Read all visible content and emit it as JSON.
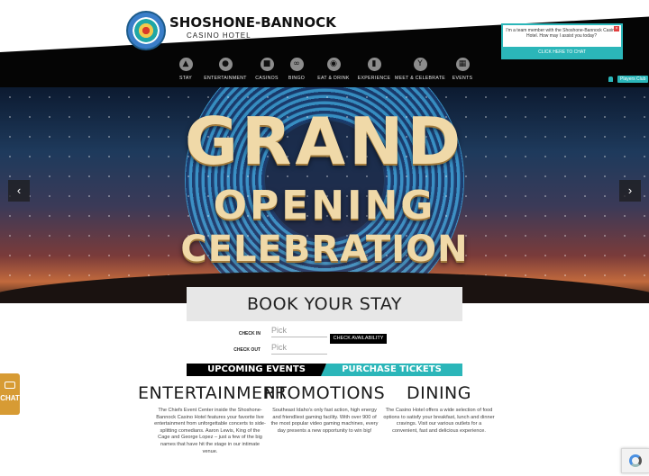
{
  "brand": {
    "name": "SHOSHONE-BANNOCK",
    "subtitle": "CASINO HOTEL"
  },
  "nav": {
    "items": [
      {
        "label": "STAY",
        "icon": "bell-icon"
      },
      {
        "label": "ENTERTAINMENT",
        "icon": "microphone-icon"
      },
      {
        "label": "CASINOS",
        "icon": "slot-machine-icon"
      },
      {
        "label": "BINGO",
        "icon": "bingo-balls-icon"
      },
      {
        "label": "EAT & DRINK",
        "icon": "plate-icon"
      },
      {
        "label": "EXPERIENCE",
        "icon": "backpack-icon"
      },
      {
        "label": "MEET & CELEBRATE",
        "icon": "glasses-icon"
      },
      {
        "label": "EVENTS",
        "icon": "calendar-icon"
      }
    ],
    "players_club": "Players Club"
  },
  "chat_popup": {
    "message": "I'm a team member with the Shoshone-Bannock Casino Hotel. How may I assist you today?",
    "button": "CLICK HERE TO CHAT",
    "close": "×"
  },
  "hero": {
    "line1": "GRAND",
    "line2": "OPENING",
    "line3": "CELEBRATION",
    "prev": "‹",
    "next": "›"
  },
  "booking": {
    "title": "BOOK YOUR STAY",
    "checkin_label": "CHECK IN",
    "checkout_label": "CHECK OUT",
    "checkin_placeholder": "Pick",
    "checkout_placeholder": "Pick",
    "button": "CHECK AVAILABILITY"
  },
  "cta": {
    "events": "UPCOMING EVENTS",
    "tickets": "PURCHASE TICKETS"
  },
  "columns": [
    {
      "title": "ENTERTAINMENT",
      "body": "The Chiefs Event Center inside the Shoshone-Bannock Casino Hotel features your favorite live entertainment from unforgettable concerts to side-splitting comedians. Aaron Lewis, King of the Cage and George Lopez – just a few of the big names that have hit the stage in our intimate venue."
    },
    {
      "title": "PROMOTIONS",
      "body": "Southeast Idaho's only fast action, high energy and friendliest gaming facility. With over 900 of the most popular video gaming machines, every day presents a new opportunity to win big!"
    },
    {
      "title": "DINING",
      "body": "The Casino Hotel offers a wide selection of food options to satisfy your breakfast, lunch and dinner cravings. Visit our various outlets for a convenient, fast and delicious experience."
    }
  ],
  "side_chat": {
    "label": "CHAT"
  },
  "colors": {
    "accent": "#2bb6b9",
    "header_bg": "#050505",
    "chat_tab": "#d79b34"
  }
}
